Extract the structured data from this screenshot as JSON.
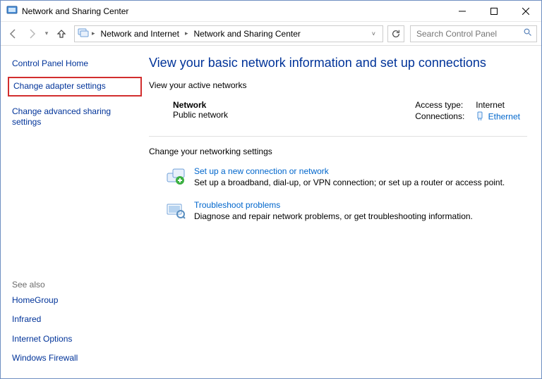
{
  "titlebar": {
    "title": "Network and Sharing Center"
  },
  "nav": {
    "seg1": "Network and Internet",
    "seg2": "Network and Sharing Center",
    "search_placeholder": "Search Control Panel"
  },
  "sidebar": {
    "home": "Control Panel Home",
    "adapter": "Change adapter settings",
    "advanced": "Change advanced sharing settings",
    "seealso_label": "See also",
    "seealso": {
      "homegroup": "HomeGroup",
      "infrared": "Infrared",
      "inetopts": "Internet Options",
      "firewall": "Windows Firewall"
    }
  },
  "main": {
    "title": "View your basic network information and set up connections",
    "active_label": "View your active networks",
    "network": {
      "name": "Network",
      "type": "Public network",
      "access_label": "Access type:",
      "access_value": "Internet",
      "conn_label": "Connections:",
      "conn_value": "Ethernet"
    },
    "change_label": "Change your networking settings",
    "setup": {
      "title": "Set up a new connection or network",
      "desc": "Set up a broadband, dial-up, or VPN connection; or set up a router or access point."
    },
    "troubleshoot": {
      "title": "Troubleshoot problems",
      "desc": "Diagnose and repair network problems, or get troubleshooting information."
    }
  }
}
